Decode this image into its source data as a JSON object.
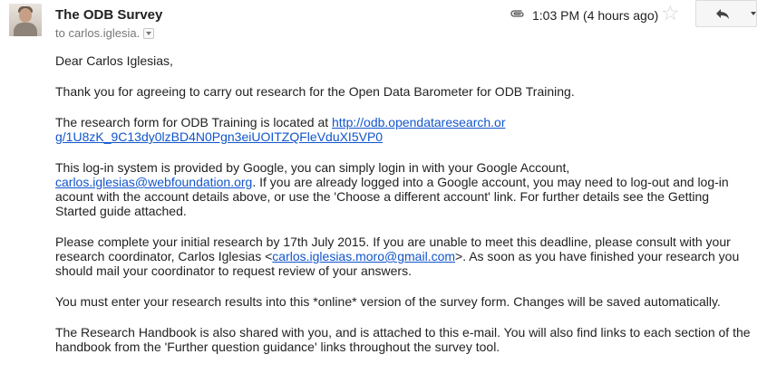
{
  "header": {
    "sender": "The ODB Survey",
    "to_text": "to carlos.iglesia.",
    "time": "1:03 PM (4 hours ago)"
  },
  "icons": {
    "avatar": "sender-avatar",
    "attachment": "paperclip-icon",
    "star": "star-icon",
    "reply": "reply-arrow-icon",
    "more": "chevron-down-icon",
    "recipient_details": "chevron-down-icon"
  },
  "colors": {
    "link": "#1155cc",
    "text": "#222222",
    "muted": "#777777"
  },
  "body": {
    "greeting": "Dear Carlos Iglesias,",
    "p1": "Thank you for agreeing to carry out research for the Open Data Barometer for ODB Training.",
    "p2_prefix": "The research form for ODB Training is located at ",
    "p2_link_a": "http://odb.opendataresearch.or",
    "p2_link_b": "g/1U8zK_9C13dy0lzBD4N0Pgn3eiUOITZQFleVduXI5VP0",
    "p3_prefix": "This log-in system is provided by Google, you can simply login in with your Google Account,",
    "p3_link": "carlos.iglesias@webfoundation.org",
    "p3_suffix": ". If you are already logged into a Google account, you may need to log-out and log-in acount with the account details above, or use the 'Choose a different account' link. For further details see the Getting Started guide attached.",
    "p4_prefix": "Please complete your initial research by 17th July 2015. If you are unable to meet this deadline, please consult with your research coordinator, Carlos Iglesias <",
    "p4_link": "carlos.iglesias.moro@gmail.com",
    "p4_suffix": ">. As soon as you have finished your research you should mail your coordinator to request review of your answers.",
    "p5": "You must enter your research results into this *online* version of the survey form. Changes will be saved automatically.",
    "p6": "The Research Handbook is also shared with you, and is attached to this e-mail. You will also find links to each section of the handbook from the 'Further question guidance' links throughout the survey tool."
  }
}
